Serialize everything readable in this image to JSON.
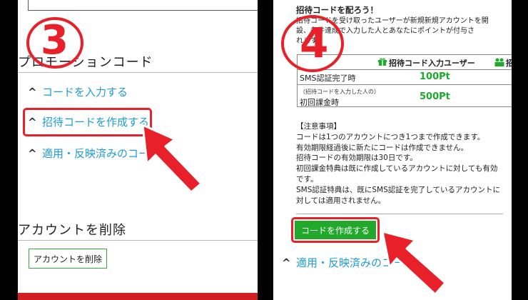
{
  "left_panel": {
    "step_number": "3",
    "promo_heading": "プロモーションコード",
    "links": [
      {
        "chevron": "^",
        "label": "コードを入力する"
      },
      {
        "chevron": "^",
        "label": "招待コードを作成する"
      },
      {
        "chevron": "^",
        "label": "適用・反映済みのコード"
      }
    ],
    "delete_heading": "アカウントを削除",
    "delete_button": "アカウントを削除"
  },
  "right_panel": {
    "step_number": "4",
    "invite_title": "招待コードを配ろう！",
    "invite_line1": "招待コードを受け取ったユーザーが新規新規アカウントを開",
    "invite_line2": "設、条件達成で入力した人とあなたにポイントが付与さ",
    "invite_line3": "れます。",
    "table": {
      "header": "招待コード入力ユーザー",
      "header_extra": "招",
      "rows": [
        {
          "sub": "",
          "label": "SMS認証完了時",
          "value": "100Pt"
        },
        {
          "sub": "（招待コードを入力した人の）",
          "label": "初回課金時",
          "value": "500Pt"
        }
      ]
    },
    "notes": [
      "【注意事項】",
      "コードは1つのアカウントにつき1つまで作成できます。",
      "有効期限経過後に新たにコードは作成できません。",
      "招待コードの有効期限は30日です。",
      "初回課金特典は既に作成しているアカウントに対しても有効",
      "です。",
      "SMS認証特典は、既にSMS認証を完了しているアカウントに",
      "対しては適用されません。"
    ],
    "make_code_button": "コードを作成する",
    "applied_link": {
      "chevron": "^",
      "label": "適用・反映済みのコード"
    }
  },
  "colors": {
    "highlight_red": "#e8202a",
    "link_blue": "#1e9cd6",
    "button_green": "#22a92c",
    "points_green": "#1aab2a"
  },
  "icons": [
    "gift-icon",
    "users-icon",
    "chevron-up-icon",
    "red-arrow-icon"
  ]
}
